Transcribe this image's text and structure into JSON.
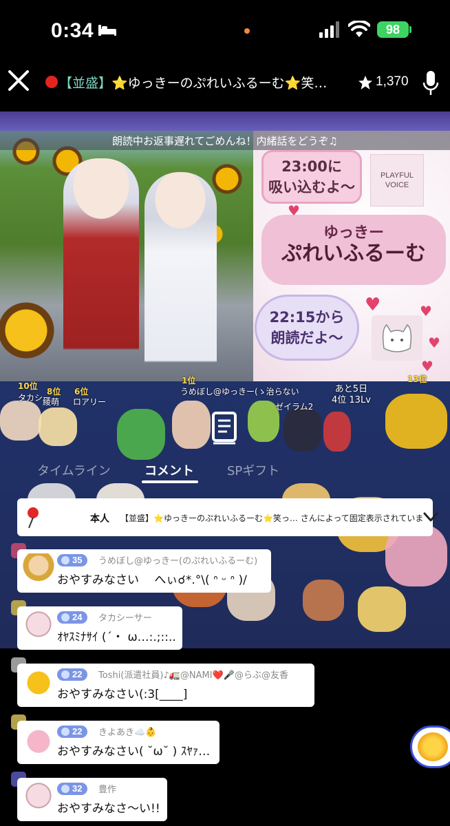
{
  "status_bar": {
    "time": "0:34",
    "battery": "98"
  },
  "header": {
    "title_prefix": "【並盛】",
    "title_rest": "⭐ゆっきーのぷれいふるーむ⭐笑ってお…",
    "star_count": "1,370"
  },
  "video": {
    "caption": "朗読中お返事遅れてごめんね！内緒話をどうぞ♫",
    "card_time1_line1": "23:00に",
    "card_time1_line2": "吸い込むよ〜",
    "voice_badge_line1": "PLAYFUL",
    "voice_badge_line2": "VOICE",
    "card_name_line1": "ゆっきー",
    "card_name_line2": "ぷれいふるーむ",
    "card_time2_line1": "22:15から",
    "card_time2_line2": "朗読だよ〜"
  },
  "rankings": [
    {
      "rank": "10位",
      "name": "タカシー"
    },
    {
      "rank": "8位",
      "name": "綾萌"
    },
    {
      "rank": "6位",
      "name": "ロアリー"
    },
    {
      "rank": "1位",
      "name": "うめぼし@ゆっきー(ゝ治らない"
    },
    {
      "rank": "13位",
      "name": "ゼイラム2"
    }
  ],
  "countdown": {
    "line1": "あと5日",
    "line2": "4位 13Lv"
  },
  "tabs": [
    {
      "label": "タイムライン"
    },
    {
      "label": "コメント"
    },
    {
      "label": "SPギフト"
    }
  ],
  "pinned": {
    "owner": "本人",
    "text": "【並盛】⭐ゆっきーのぷれいふるーむ⭐笑っ… さんによって固定表示されています。"
  },
  "comments": [
    {
      "level": "35",
      "name": "うめぼし@ゆっきー(のぷれいふるーむ)",
      "text": "おやすみなさい　 へぃ☌*.°\\( ᐢ ᵕ ᐢ )/"
    },
    {
      "level": "24",
      "name": "タカシーサー",
      "text": "ｵﾔｽﾐﾅｻｲ (´・ ω…:.;::.."
    },
    {
      "level": "22",
      "name": "Toshi(派遣社員)♪🚛@NAMI❤️🎤@らぶ@友香",
      "text": "おやすみなさい(:3[____]"
    },
    {
      "level": "22",
      "name": "きよあき☁️👶",
      "text": "おやすみなさい( ˘ω˘ ) ｽﾔｧ…"
    },
    {
      "level": "32",
      "name": "豊作",
      "text": "おやすみなさ〜い!!"
    }
  ],
  "colors": {
    "live_dot": "#e2241f",
    "battery": "#3dd463",
    "level_badge": "#7b95e6",
    "tab_active": "#ffffff"
  }
}
